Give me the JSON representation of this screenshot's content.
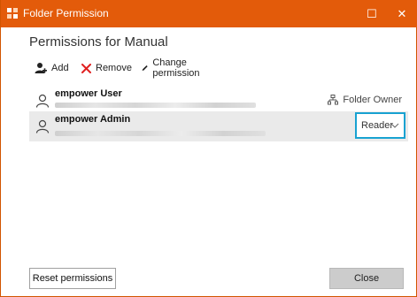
{
  "window": {
    "title": "Folder Permission",
    "maximize_glyph": "☐",
    "close_glyph": "✕",
    "accent_color": "#e35b0a"
  },
  "dialog": {
    "heading": "Permissions for Manual"
  },
  "toolbar": {
    "add_label": "Add",
    "remove_label": "Remove",
    "change_label": "Change permission"
  },
  "permissions": [
    {
      "name": "empower User",
      "role": "Folder Owner",
      "icon": "owner-icon"
    },
    {
      "name": "empower Admin",
      "role": "Reader",
      "icon": "chevron-down-icon"
    }
  ],
  "footer": {
    "reset_label": "Reset permissions",
    "close_label": "Close"
  },
  "colors": {
    "selected_border": "#18a2d1",
    "remove_icon": "#e02020"
  }
}
